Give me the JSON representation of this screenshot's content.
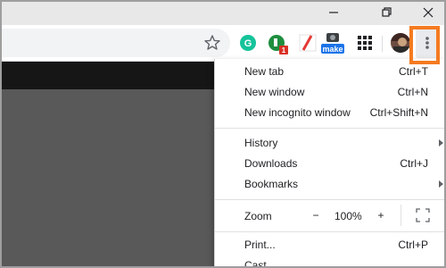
{
  "window": {
    "minimize_icon": "minimize-icon",
    "restore_icon": "restore-icon",
    "close_icon": "close-icon"
  },
  "toolbar": {
    "bookmark_icon": "star-icon",
    "extensions": [
      {
        "name": "grammarly-extension",
        "letter": "G",
        "color": "#15c39a"
      },
      {
        "name": "ext-green-badge",
        "letter": "",
        "color": "#1e8e3e",
        "badge": "1",
        "badge_color": "#d93025"
      },
      {
        "name": "ext-red-slash",
        "color": "#e53935"
      },
      {
        "name": "ext-make",
        "label": "make",
        "color": "#1a73e8"
      },
      {
        "name": "apps-grid",
        "color": "#202124"
      }
    ],
    "menu_icon": "more-vertical-icon",
    "highlight_color": "#f47b20"
  },
  "menu": {
    "items": [
      {
        "label": "New tab",
        "shortcut": "Ctrl+T"
      },
      {
        "label": "New window",
        "shortcut": "Ctrl+N"
      },
      {
        "label": "New incognito window",
        "shortcut": "Ctrl+Shift+N"
      },
      {
        "label": "History",
        "shortcut": ""
      },
      {
        "label": "Downloads",
        "shortcut": "Ctrl+J"
      },
      {
        "label": "Bookmarks",
        "shortcut": ""
      }
    ],
    "zoom": {
      "label": "Zoom",
      "minus": "−",
      "value": "100%",
      "plus": "+"
    },
    "bottom_items": [
      {
        "label": "Print...",
        "shortcut": "Ctrl+P"
      },
      {
        "label": "Cast...",
        "shortcut": ""
      }
    ]
  }
}
